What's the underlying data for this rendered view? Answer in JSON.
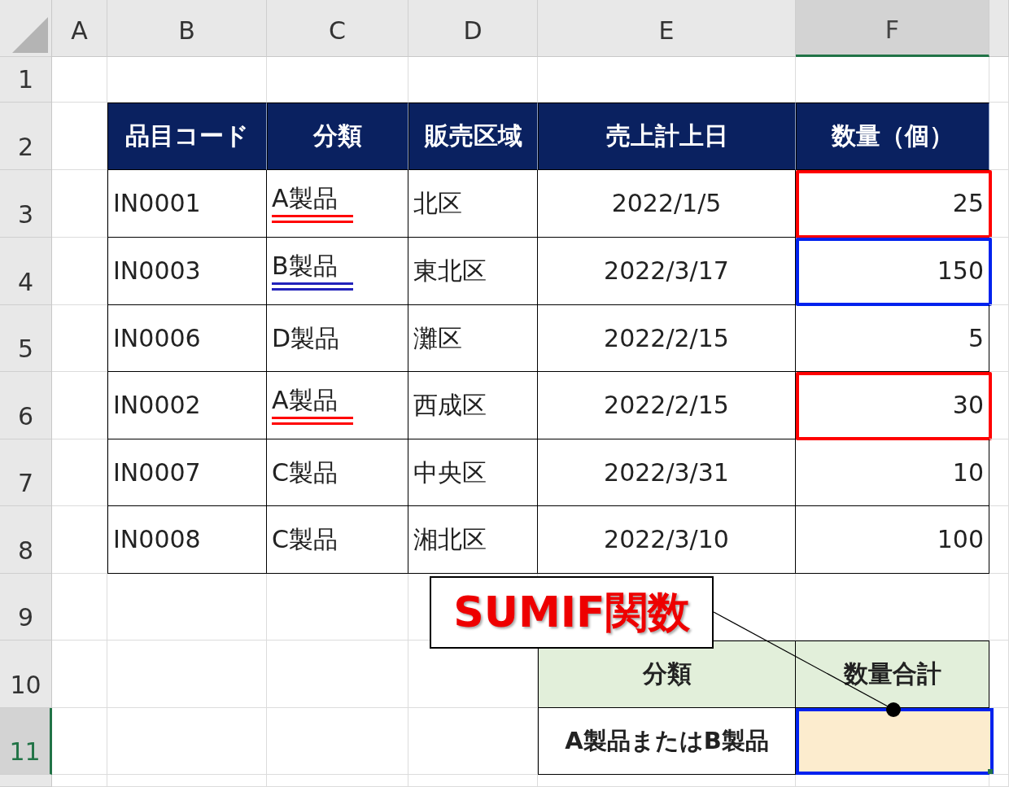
{
  "sheet": {
    "columns": [
      {
        "label": "A",
        "selected": false
      },
      {
        "label": "B",
        "selected": false
      },
      {
        "label": "C",
        "selected": false
      },
      {
        "label": "D",
        "selected": false
      },
      {
        "label": "E",
        "selected": false
      },
      {
        "label": "F",
        "selected": true
      }
    ],
    "rows": [
      {
        "label": "1",
        "selected": false
      },
      {
        "label": "2",
        "selected": false
      },
      {
        "label": "3",
        "selected": false
      },
      {
        "label": "4",
        "selected": false
      },
      {
        "label": "5",
        "selected": false
      },
      {
        "label": "6",
        "selected": false
      },
      {
        "label": "7",
        "selected": false
      },
      {
        "label": "8",
        "selected": false
      },
      {
        "label": "9",
        "selected": false
      },
      {
        "label": "10",
        "selected": false
      },
      {
        "label": "11",
        "selected": true
      }
    ]
  },
  "table": {
    "header": [
      "品目コード",
      "分類",
      "販売区域",
      "売上計上日",
      "数量（個）"
    ],
    "rows": [
      {
        "cells": [
          "IN0001",
          "A製品",
          "北区",
          "2022/1/5",
          "25"
        ],
        "underline": {
          "color": "#ff0000"
        },
        "box": {
          "color": "#ff0000"
        }
      },
      {
        "cells": [
          "IN0003",
          "B製品",
          "東北区",
          "2022/3/17",
          "150"
        ],
        "underline": {
          "color": "#2222bb"
        },
        "box": {
          "color": "#0022ee"
        }
      },
      {
        "cells": [
          "IN0006",
          "D製品",
          "灘区",
          "2022/2/15",
          "5"
        ]
      },
      {
        "cells": [
          "IN0002",
          "A製品",
          "西成区",
          "2022/2/15",
          "30"
        ],
        "underline": {
          "color": "#ff0000"
        },
        "box": {
          "color": "#ff0000"
        }
      },
      {
        "cells": [
          "IN0007",
          "C製品",
          "中央区",
          "2022/3/31",
          "10"
        ]
      },
      {
        "cells": [
          "IN0008",
          "C製品",
          "湘北区",
          "2022/3/10",
          "100"
        ]
      }
    ]
  },
  "summary": {
    "header": [
      "分類",
      "数量合計"
    ],
    "label": "A製品またはB製品",
    "answer_selected": true
  },
  "callout": {
    "text": "SUMIF関数"
  }
}
